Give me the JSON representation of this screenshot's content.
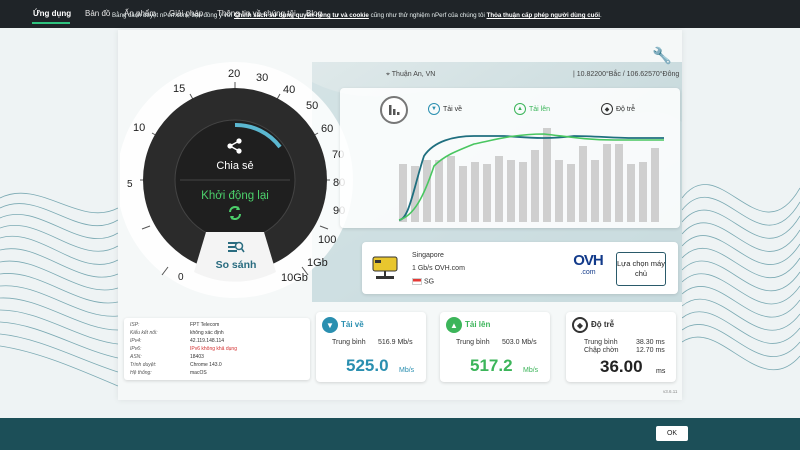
{
  "nav": {
    "items": [
      "Ứng dụng",
      "Bản đồ",
      "Ấn phẩm",
      "Giải pháp",
      "Thông tin về chúng tôi",
      "Blog"
    ],
    "active_index": 0
  },
  "location": {
    "place": "Thuận An, VN",
    "coords": "10.82200°Bắc / 106.62570°Đông"
  },
  "gauge": {
    "ticks": [
      "0",
      "5",
      "10",
      "15",
      "20",
      "30",
      "40",
      "50",
      "60",
      "70",
      "80",
      "90",
      "100",
      "1Gb",
      "10Gb"
    ],
    "share_label": "Chia sẻ",
    "restart_label": "Khởi động lại",
    "compare_label": "So sánh"
  },
  "graph_legend": {
    "download": "Tải về",
    "upload": "Tải lên",
    "latency": "Độ trễ"
  },
  "server": {
    "city": "Singapore",
    "provider": "1 Gb/s OVH.com",
    "country": "SG",
    "logo_main": "OVH",
    "logo_suffix": ".com",
    "choose_button": "Lựa chọn máy chủ"
  },
  "info": {
    "rows": [
      {
        "label": "ISP:",
        "value": "FPT Telecom",
        "warn": false
      },
      {
        "label": "Kiểu kết nối:",
        "value": "không xác định",
        "warn": false
      },
      {
        "label": "IPv4:",
        "value": "42.119.148.114",
        "warn": false
      },
      {
        "label": "IPv6:",
        "value": "IPv6 không khả dụng",
        "warn": true
      },
      {
        "label": "ASN:",
        "value": "18403",
        "warn": false
      },
      {
        "label": "Trình duyệt:",
        "value": "Chrome 143.0",
        "warn": false
      },
      {
        "label": "Hệ thống:",
        "value": "macOS",
        "warn": false
      }
    ]
  },
  "download": {
    "title": "Tải về",
    "avg_label": "Trung bình",
    "avg_value": "516.9 Mb/s",
    "big_value": "525.0",
    "unit": "Mb/s",
    "color": "#2a8fb0"
  },
  "upload": {
    "title": "Tải lên",
    "avg_label": "Trung bình",
    "avg_value": "503.0 Mb/s",
    "big_value": "517.2",
    "unit": "Mb/s",
    "color": "#3cb55a"
  },
  "latency": {
    "title": "Độ trễ",
    "avg_label": "Trung bình",
    "avg_value": "38.30 ms",
    "jitter_label": "Chập chờn",
    "jitter_value": "12.70 ms",
    "big_value": "36.00",
    "unit": "ms"
  },
  "version": "v3.6.11",
  "cookie": {
    "prefix": "Bằng cách duyệt nPerf.com, bạn đồng ý với",
    "link1": "Chính sách sử dụng quyền riêng tư và cookie",
    "middle": "cũng như thử nghiệm nPerf của chúng tôi",
    "link2": "Thỏa thuận cấp phép người dùng cuối",
    "suffix": ".",
    "ok": "OK"
  },
  "colors": {
    "nav_bg": "#1f2428",
    "accent": "#2ec27e",
    "download": "#2a8fb0",
    "upload": "#3cb55a",
    "cookie_bg": "#1c4f58",
    "gauge_dark": "#2a2a2a"
  }
}
